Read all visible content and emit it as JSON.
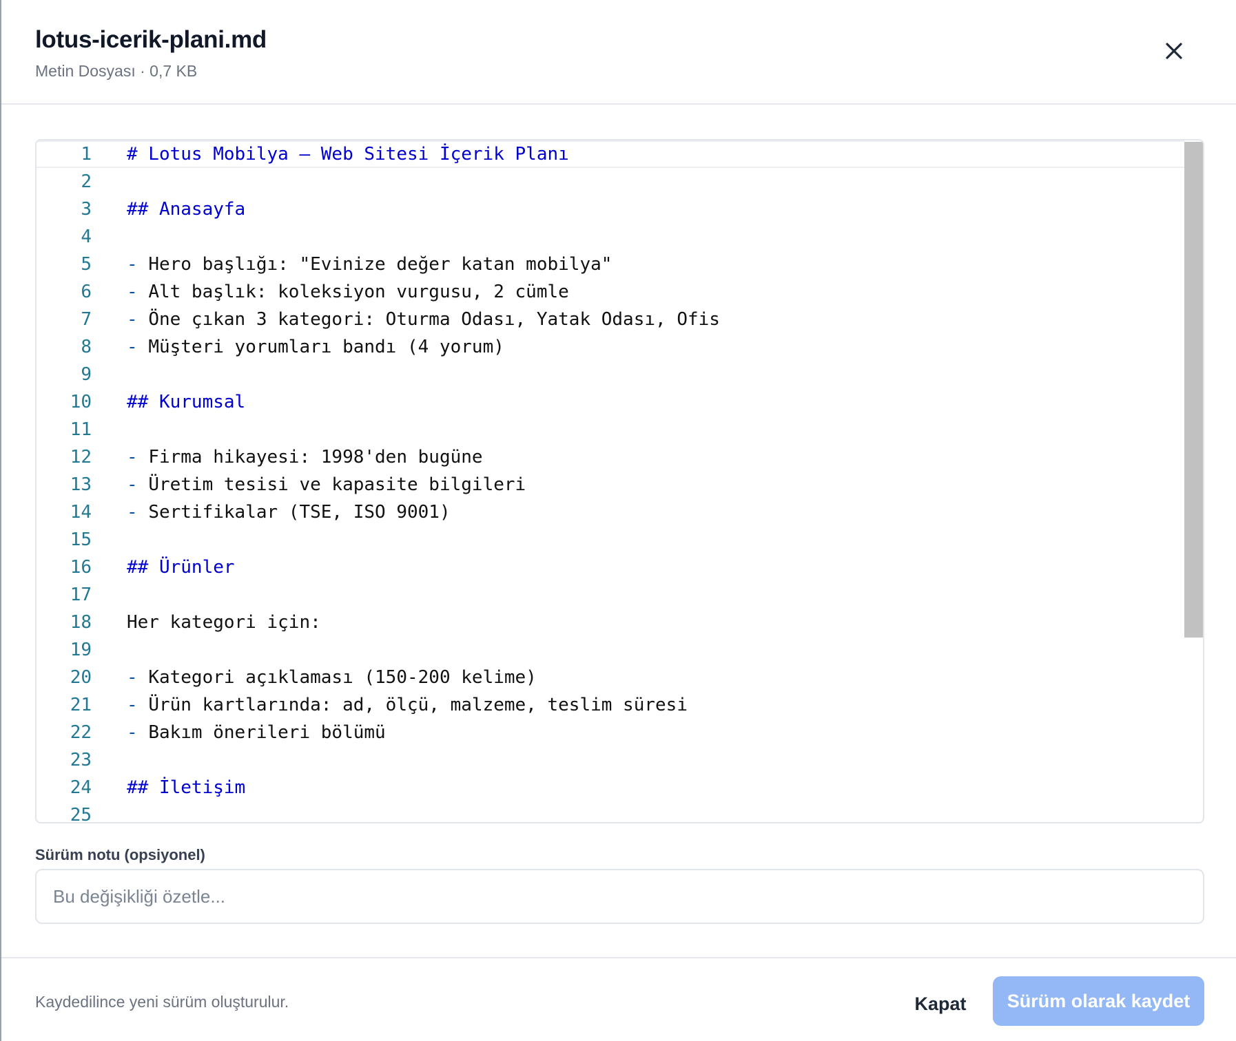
{
  "dialog": {
    "title": "lotus-icerik-plani.md",
    "subtitle": "Metin Dosyası · 0,7 KB"
  },
  "editor": {
    "lines": [
      {
        "n": "1",
        "kind": "header",
        "text": "# Lotus Mobilya – Web Sitesi İçerik Planı"
      },
      {
        "n": "2",
        "kind": "plain",
        "text": ""
      },
      {
        "n": "3",
        "kind": "header",
        "text": "## Anasayfa"
      },
      {
        "n": "4",
        "kind": "plain",
        "text": ""
      },
      {
        "n": "5",
        "kind": "list",
        "text": "Hero başlığı: \"Evinize değer katan mobilya\""
      },
      {
        "n": "6",
        "kind": "list",
        "text": "Alt başlık: koleksiyon vurgusu, 2 cümle"
      },
      {
        "n": "7",
        "kind": "list",
        "text": "Öne çıkan 3 kategori: Oturma Odası, Yatak Odası, Ofis"
      },
      {
        "n": "8",
        "kind": "list",
        "text": "Müşteri yorumları bandı (4 yorum)"
      },
      {
        "n": "9",
        "kind": "plain",
        "text": ""
      },
      {
        "n": "10",
        "kind": "header",
        "text": "## Kurumsal"
      },
      {
        "n": "11",
        "kind": "plain",
        "text": ""
      },
      {
        "n": "12",
        "kind": "list",
        "text": "Firma hikayesi: 1998'den bugüne"
      },
      {
        "n": "13",
        "kind": "list",
        "text": "Üretim tesisi ve kapasite bilgileri"
      },
      {
        "n": "14",
        "kind": "list",
        "text": "Sertifikalar (TSE, ISO 9001)"
      },
      {
        "n": "15",
        "kind": "plain",
        "text": ""
      },
      {
        "n": "16",
        "kind": "header",
        "text": "## Ürünler"
      },
      {
        "n": "17",
        "kind": "plain",
        "text": ""
      },
      {
        "n": "18",
        "kind": "plain",
        "text": "Her kategori için:"
      },
      {
        "n": "19",
        "kind": "plain",
        "text": ""
      },
      {
        "n": "20",
        "kind": "list",
        "text": "Kategori açıklaması (150-200 kelime)"
      },
      {
        "n": "21",
        "kind": "list",
        "text": "Ürün kartlarında: ad, ölçü, malzeme, teslim süresi"
      },
      {
        "n": "22",
        "kind": "list",
        "text": "Bakım önerileri bölümü"
      },
      {
        "n": "23",
        "kind": "plain",
        "text": ""
      },
      {
        "n": "24",
        "kind": "header",
        "text": "## İletişim"
      },
      {
        "n": "25",
        "kind": "plain",
        "text": ""
      }
    ]
  },
  "version_note": {
    "label": "Sürüm notu (opsiyonel)",
    "placeholder": "Bu değişikliği özetle...",
    "value": ""
  },
  "footer": {
    "hint": "Kaydedilince yeni sürüm oluşturulur.",
    "close_label": "Kapat",
    "save_label": "Sürüm olarak kaydet"
  },
  "icons": {
    "close": "close-icon"
  },
  "colors": {
    "primary_disabled": "#93b8f5",
    "line_number": "#237893",
    "markdown_header": "#0000d0"
  }
}
